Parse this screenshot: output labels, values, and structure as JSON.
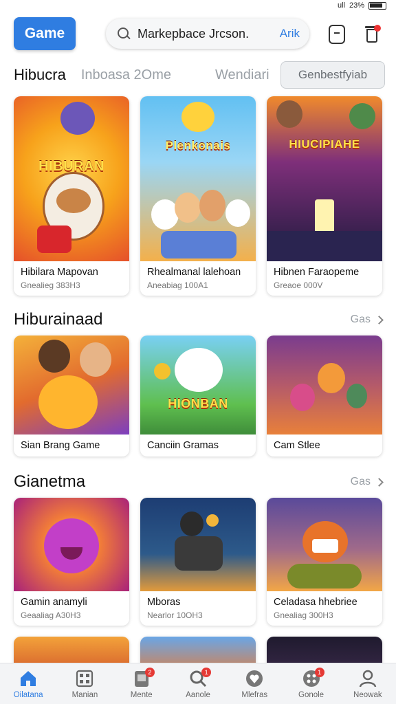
{
  "status": {
    "signal": "ull",
    "battery_text": "23%"
  },
  "header": {
    "brand_button": "Game",
    "search_query": "Markepbace Jrcson.",
    "search_action": "Arik"
  },
  "tabs": {
    "items": [
      "Hibucra",
      "Inboasa 2Ome",
      "Wendiari"
    ],
    "button_label": "Genbestfyiab"
  },
  "sections": [
    {
      "title": "",
      "more_label": "",
      "cards": [
        {
          "title": "Hibilara Mapovan",
          "sub": "Gnealieg 383H3",
          "art_label": "HIBURAN",
          "colors": [
            "#f7a21b",
            "#e5502a"
          ]
        },
        {
          "title": "Rhealmanal lalehoan",
          "sub": "Aneabiag 100A1",
          "art_label": "Plenkonais",
          "colors": [
            "#6cc3f0",
            "#f3a842"
          ]
        },
        {
          "title": "Hibnen Faraopeme",
          "sub": "Greaoe 000V",
          "art_label": "HIUCIPIAHE",
          "colors": [
            "#3a2a7a",
            "#e76f2b"
          ]
        }
      ]
    },
    {
      "title": "Hiburainaad",
      "more_label": "Gas",
      "cards": [
        {
          "title": "Sian Brang Game",
          "sub": "",
          "art_label": "",
          "colors": [
            "#f08b2e",
            "#7c3fbf"
          ]
        },
        {
          "title": "Canciin Gramas",
          "sub": "",
          "art_label": "HIONBAN",
          "colors": [
            "#5fbf4f",
            "#2e8fd0"
          ]
        },
        {
          "title": "Cam Stlee",
          "sub": "",
          "art_label": "",
          "colors": [
            "#7a3c8e",
            "#e8803a"
          ]
        }
      ]
    },
    {
      "title": "Gianetma",
      "more_label": "Gas",
      "cards": [
        {
          "title": "Gamin anamyli",
          "sub": "Geaaliag A30H3",
          "art_label": "",
          "colors": [
            "#e0327a",
            "#f5b32a"
          ]
        },
        {
          "title": "Mboras",
          "sub": "Nearlor 10OH3",
          "art_label": "",
          "colors": [
            "#1d3d73",
            "#e29a3b"
          ]
        },
        {
          "title": "Celadasa hhebriee",
          "sub": "Gnealiag 300H3",
          "art_label": "",
          "colors": [
            "#5a4a9a",
            "#f2a646"
          ]
        }
      ]
    }
  ],
  "bottom_nav": [
    {
      "label": "Oilatana",
      "icon": "home-icon",
      "active": true,
      "badge": ""
    },
    {
      "label": "Manian",
      "icon": "grid-icon",
      "active": false,
      "badge": ""
    },
    {
      "label": "Mente",
      "icon": "tablet-icon",
      "active": false,
      "badge": "2"
    },
    {
      "label": "Aanole",
      "icon": "search-icon",
      "active": false,
      "badge": "1"
    },
    {
      "label": "Mlefras",
      "icon": "heart-icon",
      "active": false,
      "badge": ""
    },
    {
      "label": "Gonole",
      "icon": "gamepad-icon",
      "active": false,
      "badge": "1"
    },
    {
      "label": "Neowak",
      "icon": "profile-icon",
      "active": false,
      "badge": ""
    }
  ]
}
